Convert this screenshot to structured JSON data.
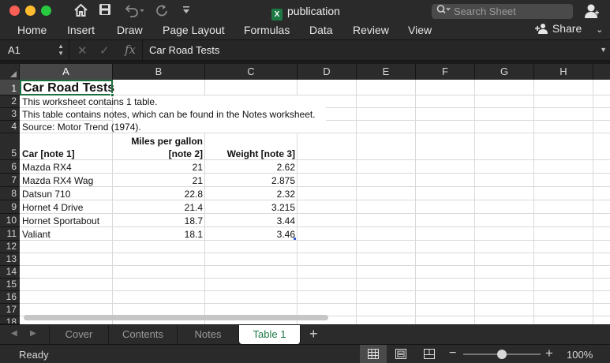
{
  "window": {
    "title": "publication"
  },
  "titlebar": {
    "search_placeholder": "Search Sheet",
    "icons": [
      "home-icon",
      "save-icon",
      "undo-icon",
      "redo-icon",
      "customize-toolbar-icon",
      "account-icon"
    ]
  },
  "ribbon": {
    "tabs": [
      "Home",
      "Insert",
      "Draw",
      "Page Layout",
      "Formulas",
      "Data",
      "Review",
      "View"
    ],
    "share_label": "Share"
  },
  "formula_bar": {
    "name_box": "A1",
    "fx_label": "fx",
    "content": "Car Road Tests"
  },
  "grid": {
    "columns": [
      "A",
      "B",
      "C",
      "D",
      "E",
      "F",
      "G",
      "H"
    ],
    "selected_column": "A",
    "selected_row": "1",
    "rows": [
      "1",
      "2",
      "3",
      "4",
      "5",
      "6",
      "7",
      "8",
      "9",
      "10",
      "11",
      "12",
      "13",
      "14",
      "15",
      "16",
      "17",
      "18"
    ],
    "cells": {
      "a1": "Car Road Tests",
      "a2": "This worksheet contains 1 table.",
      "a3": "This table contains notes, which can be found in the Notes worksheet.",
      "a4": "Source: Motor Trend (1974).",
      "a5": "Car [note 1]",
      "b5_line1": "Miles per gallon",
      "b5_line2": "[note 2]",
      "c5": "Weight [note 3]"
    },
    "table": [
      {
        "car": "Mazda RX4",
        "mpg": "21",
        "weight": "2.62"
      },
      {
        "car": "Mazda RX4 Wag",
        "mpg": "21",
        "weight": "2.875"
      },
      {
        "car": "Datsun 710",
        "mpg": "22.8",
        "weight": "2.32"
      },
      {
        "car": "Hornet 4 Drive",
        "mpg": "21.4",
        "weight": "3.215"
      },
      {
        "car": "Hornet Sportabout",
        "mpg": "18.7",
        "weight": "3.44"
      },
      {
        "car": "Valiant",
        "mpg": "18.1",
        "weight": "3.46"
      }
    ]
  },
  "sheet_tabs": {
    "tabs": [
      "Cover",
      "Contents",
      "Notes",
      "Table 1"
    ],
    "active": "Table 1"
  },
  "status_bar": {
    "status": "Ready",
    "zoom_level": "100%",
    "zoom_fraction": 0.5
  },
  "colors": {
    "accent": "#1d7a45",
    "chrome_bg": "#2a2a2a",
    "grid_line": "#d9d9d9"
  }
}
